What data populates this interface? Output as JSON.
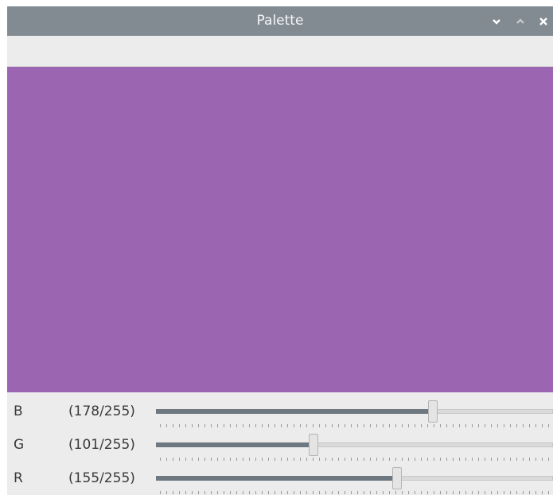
{
  "window": {
    "title": "Palette"
  },
  "titlebar": {
    "buttons": [
      {
        "name": "minimize",
        "icon": "chevron-down-icon"
      },
      {
        "name": "maximize",
        "icon": "chevron-up-icon"
      },
      {
        "name": "close",
        "icon": "close-icon"
      }
    ]
  },
  "colors": {
    "titlebar": "#838b92",
    "swatch": "#9b65b2",
    "slider_fill": "#6e7880",
    "background": "#ececec"
  },
  "sliders": [
    {
      "label": "B",
      "value_text": "(178/255)",
      "value": 178,
      "max": 255
    },
    {
      "label": "G",
      "value_text": "(101/255)",
      "value": 101,
      "max": 255
    },
    {
      "label": "R",
      "value_text": "(155/255)",
      "value": 155,
      "max": 255
    }
  ]
}
